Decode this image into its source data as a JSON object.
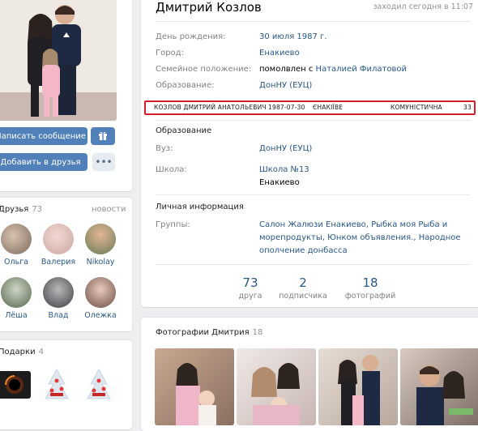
{
  "profile": {
    "name": "Дмитрий Козлов",
    "last_seen": "заходил сегодня в 11:07",
    "info": [
      {
        "label": "День рождения:",
        "value": "30 июля 1987 г."
      },
      {
        "label": "Город:",
        "value": "Енакиево"
      },
      {
        "label": "Семейное положение:",
        "value_prefix": "помолвлен с ",
        "value_link": "Наталией Филатовой"
      },
      {
        "label": "Образование:",
        "value": "ДонНУ (ЕУЦ)"
      }
    ],
    "registry_line": {
      "name": "КОЗЛОВ ДМИТРИЙ АНАТОЛЬЕВИЧ",
      "date": "1987-07-30",
      "city": "ЄНАКІЇВЕ",
      "party": "КОМУНІСТИЧНА",
      "number": "33",
      "border_color": "#d71f2a"
    },
    "education": {
      "title": "Образование",
      "university_label": "Вуз:",
      "university": "ДонНУ (ЕУЦ)",
      "school_label": "Школа:",
      "school": "Школа №13",
      "school_city": "Енакиево"
    },
    "personal": {
      "title": "Личная информация",
      "groups_label": "Группы:",
      "groups_line1": "Салон Жалюзи Енакиево, Рыбка моя Рыба и",
      "groups_line2": "морепродукты, Юнком объявления., Народное",
      "groups_line3": "ополчение донбасса"
    },
    "stats": [
      {
        "number": "73",
        "label": "друга"
      },
      {
        "number": "2",
        "label": "подписчика"
      },
      {
        "number": "18",
        "label": "фотографий"
      }
    ]
  },
  "actions": {
    "message": "Написать сообщение",
    "add_friend": "Добавить в друзья",
    "more": "•••"
  },
  "friends": {
    "title": "Друзья",
    "count": "73",
    "new_label": "новости",
    "items": [
      "Ольга",
      "Валерия",
      "Nikolay",
      "Лёша",
      "Влад",
      "Олежка"
    ]
  },
  "gifts": {
    "title": "Подарки",
    "count": "4"
  },
  "photos": {
    "title": "Фотографии Дмитрия",
    "count": "18"
  },
  "colors": {
    "accent": "#5181b8",
    "link": "#2a5885",
    "background": "#edeef0"
  },
  "icons": {
    "gift": "gift-icon",
    "more": "more-icon"
  }
}
